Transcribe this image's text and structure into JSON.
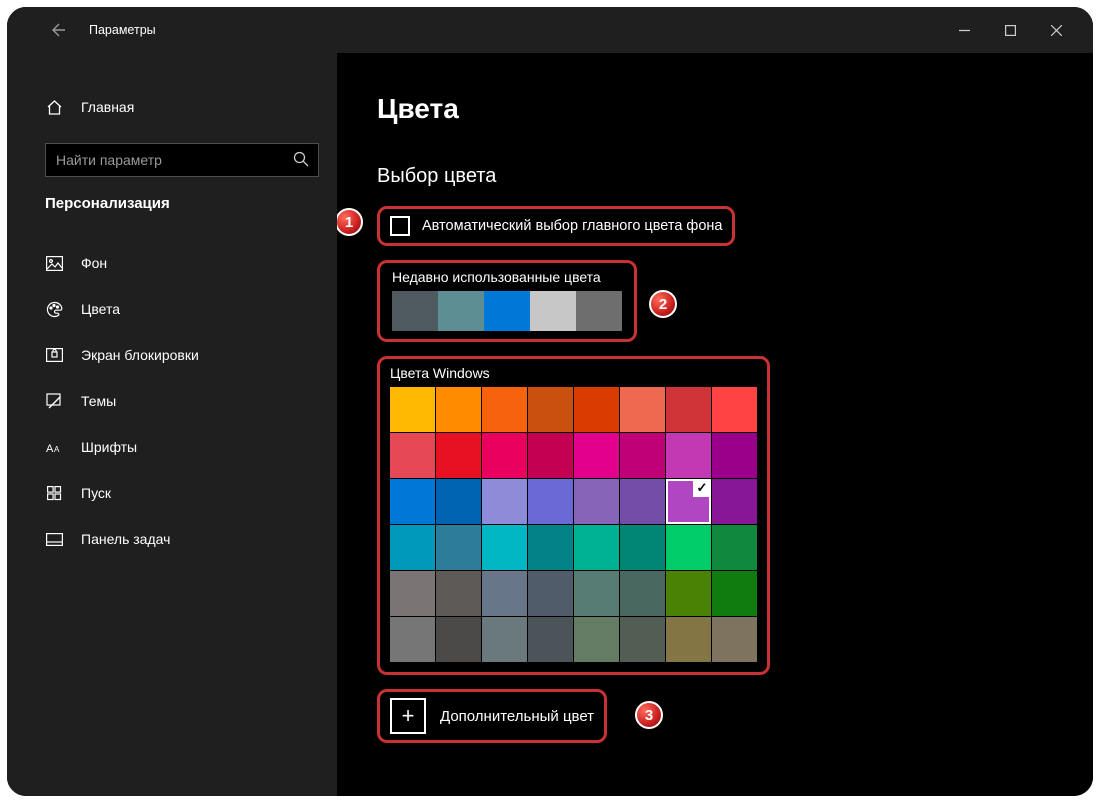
{
  "window": {
    "title": "Параметры"
  },
  "sidebar": {
    "home": "Главная",
    "search_placeholder": "Найти параметр",
    "category": "Персонализация",
    "items": [
      {
        "label": "Фон",
        "icon": "picture"
      },
      {
        "label": "Цвета",
        "icon": "palette"
      },
      {
        "label": "Экран блокировки",
        "icon": "lock"
      },
      {
        "label": "Темы",
        "icon": "brush"
      },
      {
        "label": "Шрифты",
        "icon": "font"
      },
      {
        "label": "Пуск",
        "icon": "start"
      },
      {
        "label": "Панель задач",
        "icon": "taskbar"
      }
    ]
  },
  "main": {
    "page_title": "Цвета",
    "section_title": "Выбор цвета",
    "auto_checkbox_label": "Автоматический выбор главного цвета фона",
    "recent_title": "Недавно использованные цвета",
    "recent_colors": [
      "#4e5a5f",
      "#5d8e93",
      "#0078d7",
      "#c7c7c7",
      "#6e6e6e"
    ],
    "windows_title": "Цвета Windows",
    "windows_colors": [
      "#ffb900",
      "#ff8c00",
      "#f7630c",
      "#ca5010",
      "#da3b01",
      "#ef6950",
      "#d13438",
      "#ff4343",
      "#e74856",
      "#e81123",
      "#ea005e",
      "#c30052",
      "#e3008c",
      "#bf0077",
      "#c239b3",
      "#9a0089",
      "#0078d7",
      "#0063b1",
      "#8e8cd8",
      "#6b69d6",
      "#8764b8",
      "#744da9",
      "#b146c2",
      "#881798",
      "#0099bc",
      "#2d7d9a",
      "#00b7c3",
      "#038387",
      "#00b294",
      "#018574",
      "#00cc6a",
      "#10893e",
      "#7a7574",
      "#5d5a58",
      "#68768a",
      "#515c6b",
      "#567c73",
      "#486860",
      "#498205",
      "#107c10",
      "#767676",
      "#4c4a48",
      "#69797e",
      "#4a5459",
      "#647c64",
      "#525e54",
      "#847545",
      "#7e735f"
    ],
    "selected_index": 22,
    "custom_color_label": "Дополнительный цвет"
  },
  "badges": [
    "1",
    "2",
    "3"
  ]
}
